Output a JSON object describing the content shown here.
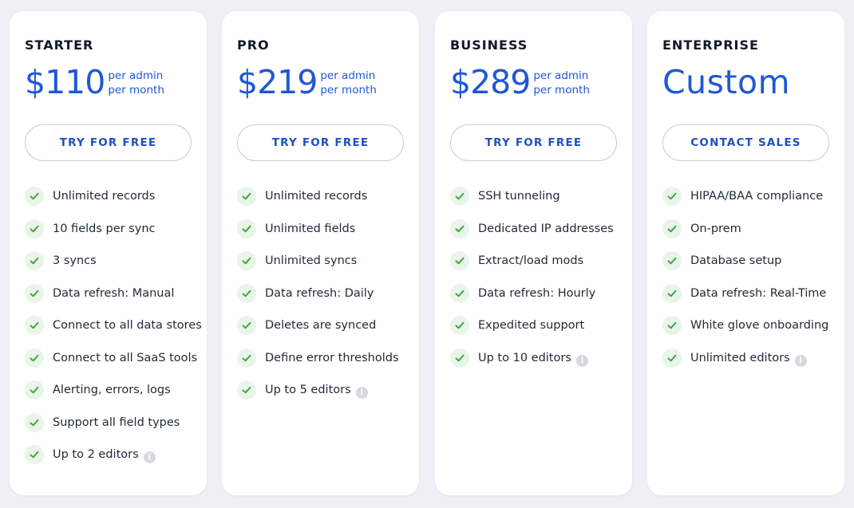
{
  "plans": [
    {
      "name": "STARTER",
      "price": "$110",
      "price_unit_line1": "per admin",
      "price_unit_line2": "per month",
      "cta": "TRY FOR FREE",
      "features": [
        "Unlimited records",
        "10 fields per sync",
        "3 syncs",
        "Data refresh: Manual",
        "Connect to all data stores",
        "Connect to all SaaS tools",
        "Alerting, errors, logs",
        "Support all field types",
        "Up to 2 editors"
      ]
    },
    {
      "name": "PRO",
      "price": "$219",
      "price_unit_line1": "per admin",
      "price_unit_line2": "per month",
      "cta": "TRY FOR FREE",
      "features": [
        "Unlimited records",
        "Unlimited fields",
        "Unlimited syncs",
        "Data refresh: Daily",
        "Deletes are synced",
        "Define error thresholds",
        "Up to 5 editors"
      ]
    },
    {
      "name": "BUSINESS",
      "price": "$289",
      "price_unit_line1": "per admin",
      "price_unit_line2": "per month",
      "cta": "TRY FOR FREE",
      "features": [
        "SSH tunneling",
        "Dedicated IP addresses",
        "Extract/load mods",
        "Data refresh: Hourly",
        "Expedited support",
        "Up to 10 editors"
      ]
    },
    {
      "name": "ENTERPRISE",
      "price": "Custom",
      "cta": "CONTACT SALES",
      "features": [
        "HIPAA/BAA compliance",
        "On-prem",
        "Database setup",
        "Data refresh: Real-Time",
        "White glove onboarding",
        "Unlimited editors"
      ]
    }
  ],
  "icons": {
    "check": "check-icon",
    "info": "info-icon",
    "info_glyph": "i"
  },
  "colors": {
    "accent": "#1f57d6",
    "check": "#3fa53a",
    "check_bg": "#e8f5e8"
  }
}
